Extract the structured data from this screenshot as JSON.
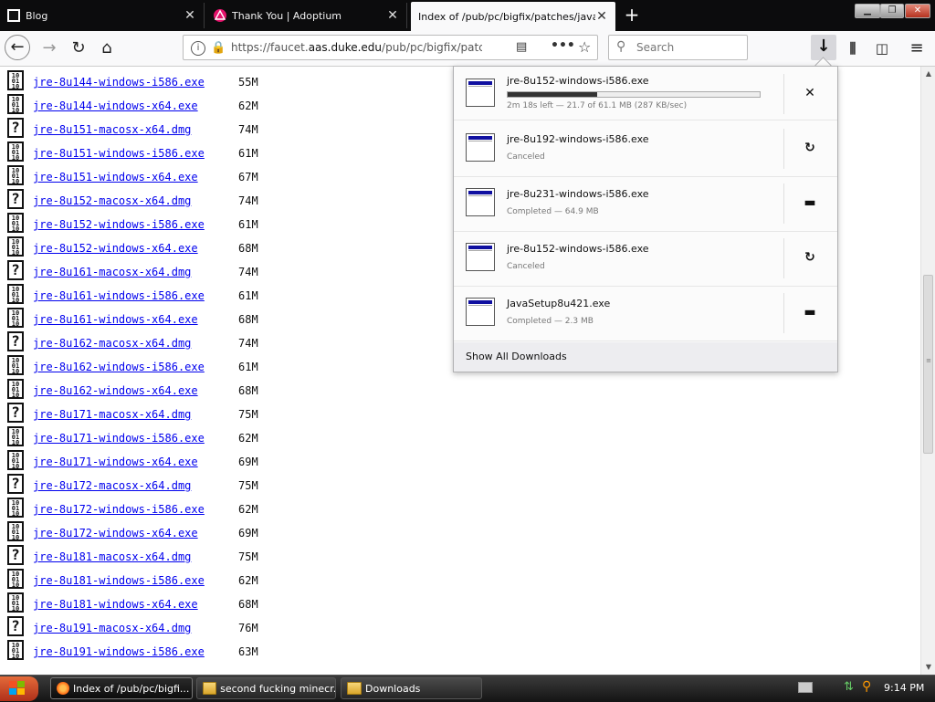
{
  "browser": {
    "tabs": [
      {
        "title": "Blog",
        "icon": "blog-icon",
        "active": false
      },
      {
        "title": "Thank You | Adoptium",
        "icon": "adoptium-icon",
        "active": false
      },
      {
        "title": "Index of /pub/pc/bigfix/patches/java",
        "icon": "",
        "active": true
      }
    ],
    "url_prefix": "https://faucet.",
    "url_domain": "aas.duke.edu",
    "url_path": "/pub/pc/bigfix/patc",
    "search_placeholder": "Search"
  },
  "files": [
    {
      "name": "jre-8u144-windows-i586.exe",
      "size": "55M",
      "type": "binary"
    },
    {
      "name": "jre-8u144-windows-x64.exe",
      "size": "62M",
      "type": "binary"
    },
    {
      "name": "jre-8u151-macosx-x64.dmg",
      "size": "74M",
      "type": "unknown"
    },
    {
      "name": "jre-8u151-windows-i586.exe",
      "size": "61M",
      "type": "binary"
    },
    {
      "name": "jre-8u151-windows-x64.exe",
      "size": "67M",
      "type": "binary"
    },
    {
      "name": "jre-8u152-macosx-x64.dmg",
      "size": "74M",
      "type": "unknown"
    },
    {
      "name": "jre-8u152-windows-i586.exe",
      "size": "61M",
      "type": "binary"
    },
    {
      "name": "jre-8u152-windows-x64.exe",
      "size": "68M",
      "type": "binary"
    },
    {
      "name": "jre-8u161-macosx-x64.dmg",
      "size": "74M",
      "type": "unknown"
    },
    {
      "name": "jre-8u161-windows-i586.exe",
      "size": "61M",
      "type": "binary"
    },
    {
      "name": "jre-8u161-windows-x64.exe",
      "size": "68M",
      "type": "binary"
    },
    {
      "name": "jre-8u162-macosx-x64.dmg",
      "size": "74M",
      "type": "unknown"
    },
    {
      "name": "jre-8u162-windows-i586.exe",
      "size": "61M",
      "type": "binary"
    },
    {
      "name": "jre-8u162-windows-x64.exe",
      "size": "68M",
      "type": "binary"
    },
    {
      "name": "jre-8u171-macosx-x64.dmg",
      "size": "75M",
      "type": "unknown"
    },
    {
      "name": "jre-8u171-windows-i586.exe",
      "size": "62M",
      "type": "binary"
    },
    {
      "name": "jre-8u171-windows-x64.exe",
      "size": "69M",
      "type": "binary"
    },
    {
      "name": "jre-8u172-macosx-x64.dmg",
      "size": "75M",
      "type": "unknown"
    },
    {
      "name": "jre-8u172-windows-i586.exe",
      "size": "62M",
      "type": "binary"
    },
    {
      "name": "jre-8u172-windows-x64.exe",
      "size": "69M",
      "type": "binary"
    },
    {
      "name": "jre-8u181-macosx-x64.dmg",
      "size": "75M",
      "type": "unknown"
    },
    {
      "name": "jre-8u181-windows-i586.exe",
      "size": "62M",
      "type": "binary"
    },
    {
      "name": "jre-8u181-windows-x64.exe",
      "size": "68M",
      "type": "binary"
    },
    {
      "name": "jre-8u191-macosx-x64.dmg",
      "size": "76M",
      "type": "unknown"
    },
    {
      "name": "jre-8u191-windows-i586.exe",
      "size": "63M",
      "type": "binary"
    }
  ],
  "downloads": {
    "items": [
      {
        "name": "jre-8u152-windows-i586.exe",
        "status": "2m 18s left — 21.7 of 61.1 MB (287 KB/sec)",
        "state": "in-progress",
        "progress": 0.355,
        "action": "cancel"
      },
      {
        "name": "jre-8u192-windows-i586.exe",
        "status": "Canceled",
        "state": "canceled",
        "action": "retry"
      },
      {
        "name": "jre-8u231-windows-i586.exe",
        "status": "Completed — 64.9 MB",
        "state": "completed",
        "action": "open-folder"
      },
      {
        "name": "jre-8u152-windows-i586.exe",
        "status": "Canceled",
        "state": "canceled",
        "action": "retry"
      },
      {
        "name": "JavaSetup8u421.exe",
        "status": "Completed — 2.3 MB",
        "state": "completed",
        "action": "open-folder"
      }
    ],
    "show_all_label": "Show All Downloads"
  },
  "taskbar": {
    "items": [
      {
        "label": "Index of /pub/pc/bigfi...",
        "icon": "firefox-icon",
        "active": true
      },
      {
        "label": "second fucking minecr...",
        "icon": "folder-icon",
        "active": false
      },
      {
        "label": "Downloads",
        "icon": "folder-icon",
        "active": false
      }
    ],
    "clock": "9:14 PM"
  },
  "colors": {
    "link": "#0000ee",
    "tab_bar": "#0c0c0d",
    "secure_lock": "#12bc00",
    "start_button": "#c0401f"
  }
}
